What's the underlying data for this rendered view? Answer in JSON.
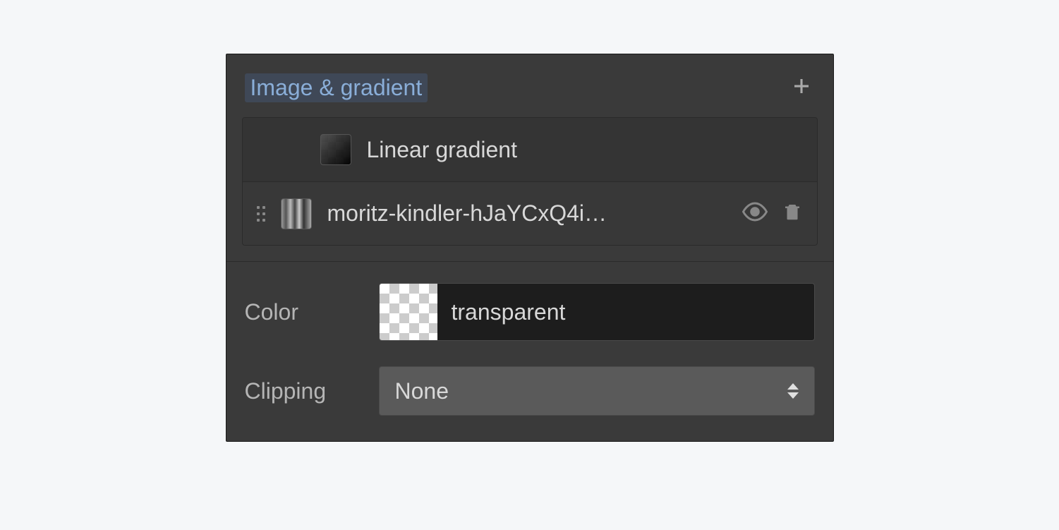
{
  "section": {
    "title": "Image & gradient"
  },
  "layers": [
    {
      "label": "Linear gradient",
      "hovered": false,
      "thumb": "gradient"
    },
    {
      "label": "moritz-kindler-hJaYCxQ4i…",
      "hovered": true,
      "thumb": "image"
    }
  ],
  "controls": {
    "color": {
      "label": "Color",
      "value": "transparent"
    },
    "clipping": {
      "label": "Clipping",
      "value": "None"
    }
  }
}
